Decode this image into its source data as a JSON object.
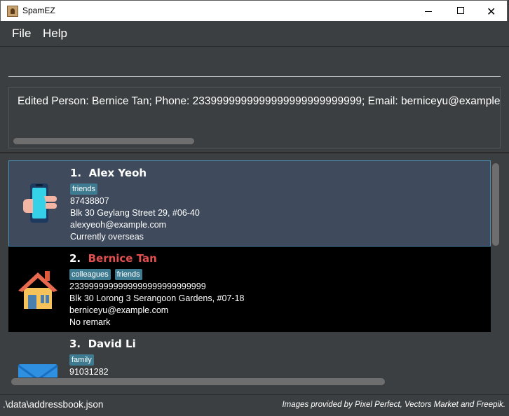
{
  "window": {
    "title": "SpamEZ",
    "minimize_icon": "minimize-icon",
    "maximize_icon": "maximize-icon",
    "close_icon": "close-icon"
  },
  "menu": {
    "file": "File",
    "help": "Help"
  },
  "command": {
    "value": "",
    "placeholder": ""
  },
  "result": {
    "text": "Edited Person: Bernice Tan; Phone: 2339999999999999999999999999; Email: berniceyu@example.com; Address: Blk 30 Lorong 3 Serangoon Gardens, #07-18; Tags: [colleagues][friends]"
  },
  "persons": [
    {
      "index": "1.",
      "name": "Alex Yeoh",
      "tags": [
        "friends"
      ],
      "phone": "87438807",
      "address": "Blk 30 Geylang Street 29, #06-40",
      "email": "alexyeoh@example.com",
      "remark": "Currently overseas",
      "icon": "phone-in-hand-icon",
      "selected": true
    },
    {
      "index": "2.",
      "name": "Bernice Tan",
      "tags": [
        "colleagues",
        "friends"
      ],
      "phone": "2339999999999999999999999999",
      "address": "Blk 30 Lorong 3 Serangoon Gardens, #07-18",
      "email": "berniceyu@example.com",
      "remark": "No remark",
      "icon": "house-icon",
      "name_color": "#e05050"
    },
    {
      "index": "3.",
      "name": "David Li",
      "tags": [
        "family"
      ],
      "phone": "91031282",
      "icon": "envelope-icon"
    }
  ],
  "status": {
    "path": ".\\data\\addressbook.json",
    "credit": "Images provided by Pixel Perfect, Vectors Market and Freepik."
  },
  "colors": {
    "background": "#3c3f41",
    "selected_card": "#3f4b5c",
    "tag": "#3e7b91",
    "highlight_name": "#e05050"
  }
}
